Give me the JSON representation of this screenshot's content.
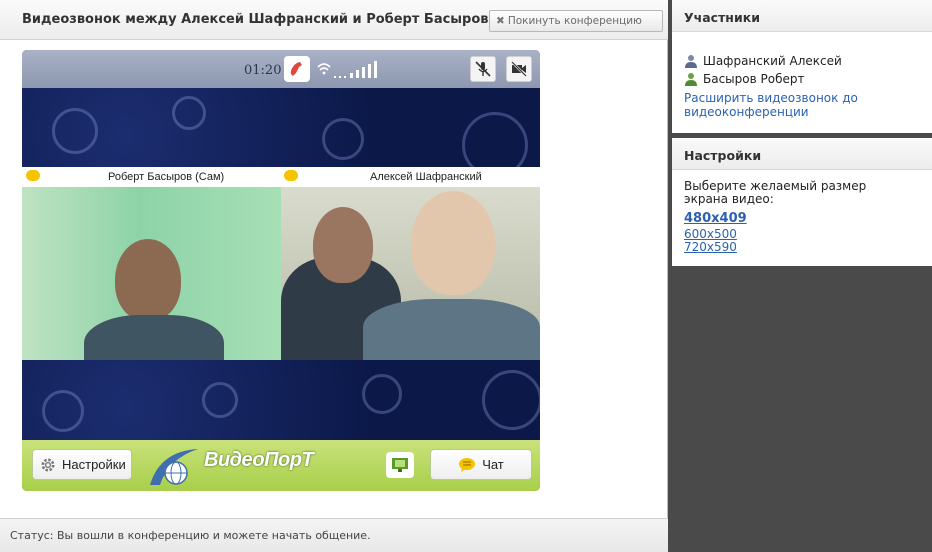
{
  "header": {
    "title": "Видеозвонок между Алексей Шафранский и Роберт Басыров",
    "leave_button": "Покинуть конференцию",
    "leave_icon": "✖"
  },
  "call": {
    "timer": "01:20",
    "icons": [
      "phone-icon",
      "signal-icon",
      "mute-mic-icon",
      "camera-off-icon"
    ]
  },
  "video": {
    "self_name": "Роберт Басыров (Сам)",
    "remote_name": "Алексей Шафранский"
  },
  "controls": {
    "settings_label": "Настройки",
    "logo_text": "ВидеоПорТ",
    "chat_label": "Чат"
  },
  "status": {
    "text": "Статус: Вы вошли в конференцию и можете начать общение."
  },
  "participants": {
    "title": "Участники",
    "items": [
      "Шафранский Алексей",
      "Басыров Роберт"
    ],
    "expand_link": "Расширить видеозвонок до видеоконференции"
  },
  "settings": {
    "title": "Настройки",
    "description": "Выберите желаемый размер экрана видео:",
    "sizes": [
      "480x409",
      "600x500",
      "720x590"
    ],
    "selected_size": "480x409"
  },
  "colors": {
    "accent_green": "#a8cf4a",
    "link_blue": "#2b62b0",
    "chat_yellow": "#f5c400",
    "background_dark": "#4a4a4a"
  }
}
